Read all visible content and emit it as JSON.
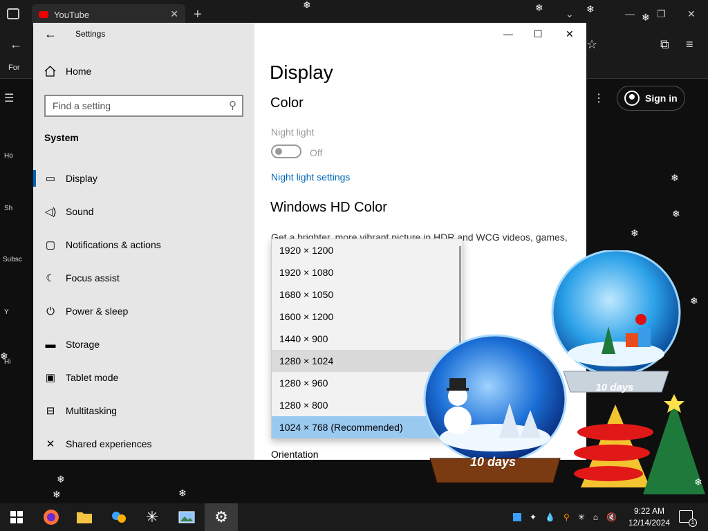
{
  "browser": {
    "tab_title": "YouTube",
    "for_text": "For",
    "left_nav": [
      "Ho",
      "Sh",
      "Subsc",
      "Y",
      "Hi"
    ],
    "sign_in": "Sign in"
  },
  "settings": {
    "window_title": "Settings",
    "home": "Home",
    "search_placeholder": "Find a setting",
    "section": "System",
    "nav": [
      {
        "label": "Display",
        "icon": "monitor-icon",
        "glyph": "▭"
      },
      {
        "label": "Sound",
        "icon": "speaker-icon",
        "glyph": "🔊"
      },
      {
        "label": "Notifications & actions",
        "icon": "message-icon",
        "glyph": "▢"
      },
      {
        "label": "Focus assist",
        "icon": "moon-icon",
        "glyph": "☾"
      },
      {
        "label": "Power & sleep",
        "icon": "power-icon",
        "glyph": "⏻"
      },
      {
        "label": "Storage",
        "icon": "storage-icon",
        "glyph": "▬"
      },
      {
        "label": "Tablet mode",
        "icon": "tablet-icon",
        "glyph": "▣"
      },
      {
        "label": "Multitasking",
        "icon": "multitask-icon",
        "glyph": "⊟"
      },
      {
        "label": "Shared experiences",
        "icon": "shared-icon",
        "glyph": "✕"
      }
    ],
    "page_title": "Display",
    "color_heading": "Color",
    "night_light_label": "Night light",
    "night_light_state": "Off",
    "night_light_link": "Night light settings",
    "hd_heading": "Windows HD Color",
    "hd_desc": "Get a brighter, more vibrant picture in HDR and WCG videos, games,",
    "orientation": "Orientation"
  },
  "resolution_dropdown": {
    "options": [
      "1920 × 1200",
      "1920 × 1080",
      "1680 × 1050",
      "1600 × 1200",
      "1440 × 900",
      "1280 × 1024",
      "1280 × 960",
      "1280 × 800",
      "1024 × 768 (Recommended)"
    ],
    "hovered": "1280 × 1024",
    "selected": "1024 × 768 (Recommended)"
  },
  "decorations": {
    "globe_left_text": "10 days",
    "globe_right_text": "10 days"
  },
  "taskbar": {
    "time": "9:22 AM",
    "date": "12/14/2024",
    "notification_count": "1"
  },
  "colors": {
    "accent": "#0063b1",
    "link": "#0067b8",
    "selected_option": "#9ac9f0",
    "taskbar": "#1b1b1b"
  }
}
